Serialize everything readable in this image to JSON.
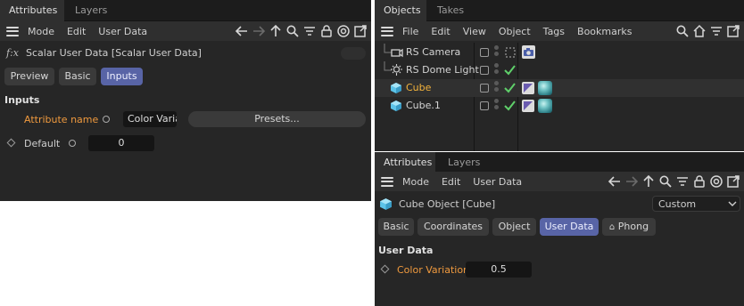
{
  "left_attributes": {
    "tabs": [
      "Attributes",
      "Layers"
    ],
    "menu": [
      "Mode",
      "Edit",
      "User Data"
    ],
    "header_title": "Scalar User Data [Scalar User Data]",
    "fx_label": "f:x",
    "sub_tabs": [
      "Preview",
      "Basic",
      "Inputs"
    ],
    "active_sub_tab": "Inputs",
    "section_title": "Inputs",
    "attribute_name_label": "Attribute name",
    "attribute_name_value": "Color Varia",
    "presets_button": "Presets...",
    "default_label": "Default",
    "default_value": "0"
  },
  "objects_panel": {
    "tabs": [
      "Objects",
      "Takes"
    ],
    "menu": [
      "File",
      "Edit",
      "View",
      "Object",
      "Tags",
      "Bookmarks"
    ],
    "rows": [
      {
        "name": "RS Camera",
        "icon": "camera-object-icon",
        "selected": false,
        "check": false
      },
      {
        "name": "RS Dome Light",
        "icon": "light-object-icon",
        "selected": false,
        "check": true
      },
      {
        "name": "Cube",
        "icon": "cube-object-icon",
        "selected": true,
        "check": true
      },
      {
        "name": "Cube.1",
        "icon": "cube-object-icon",
        "selected": false,
        "check": true
      }
    ]
  },
  "right_attributes": {
    "tabs": [
      "Attributes",
      "Layers"
    ],
    "menu": [
      "Mode",
      "Edit",
      "User Data"
    ],
    "header_title": "Cube Object [Cube]",
    "mode_dropdown": "Custom",
    "sub_tabs": [
      "Basic",
      "Coordinates",
      "Object",
      "User Data",
      "Phong"
    ],
    "active_sub_tab": "User Data",
    "section_title": "User Data",
    "field_label": "Color Variation",
    "field_value": "0.5"
  },
  "colors": {
    "panel_bg": "#262626",
    "accent_tab": "#5864a6",
    "highlight_label": "#f09a3e",
    "selected_object": "#f3b33c",
    "check_green": "#5fd06a"
  }
}
